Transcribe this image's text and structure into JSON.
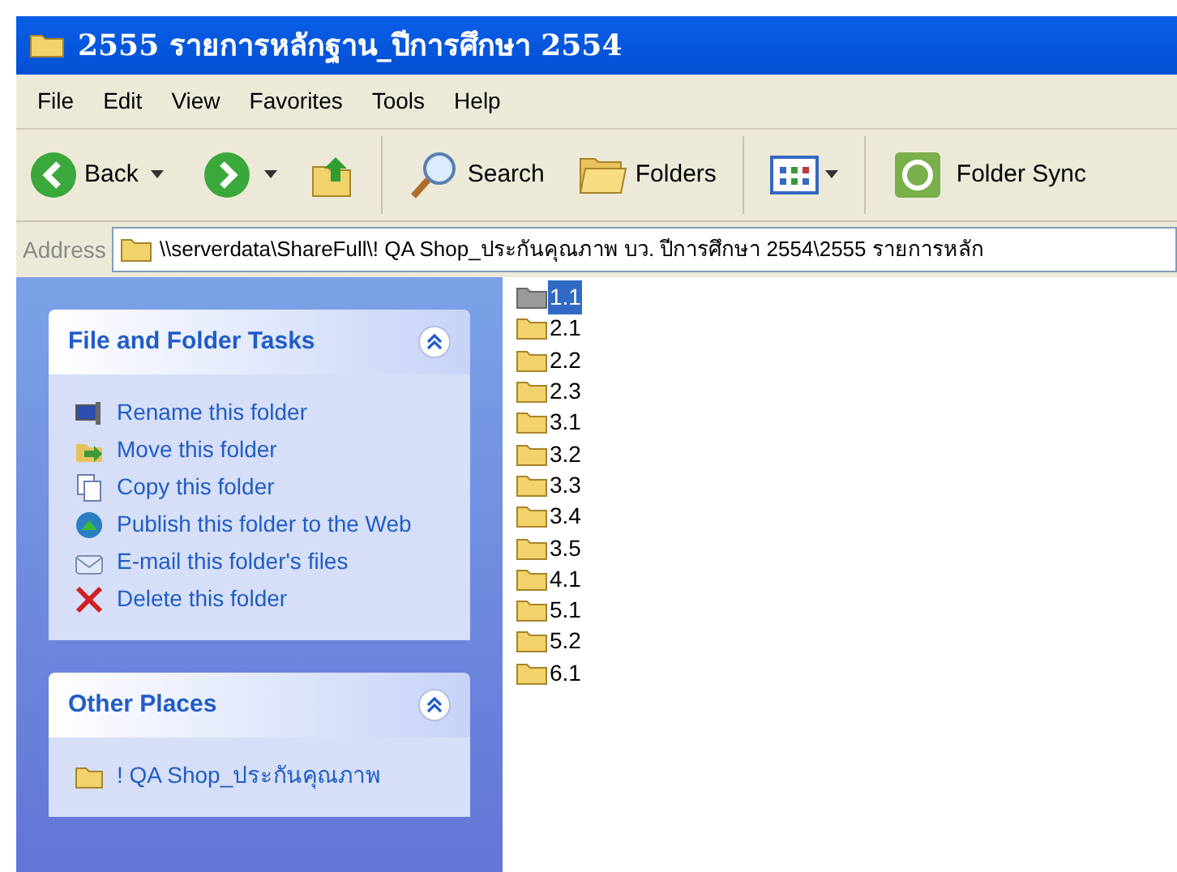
{
  "window": {
    "title": "2555 รายการหลักฐาน_ปีการศึกษา 2554"
  },
  "menu": [
    "File",
    "Edit",
    "View",
    "Favorites",
    "Tools",
    "Help"
  ],
  "toolbar": {
    "back": "Back",
    "search": "Search",
    "folders": "Folders",
    "sync": "Folder Sync"
  },
  "address": {
    "label": "Address",
    "value": "\\\\serverdata\\ShareFull\\! QA Shop_ประกันคุณภาพ บว. ปีการศึกษา 2554\\2555 รายการหลัก"
  },
  "panels": [
    {
      "title": "File and Folder Tasks",
      "expanded": true,
      "items": [
        {
          "kind": "rename",
          "label": "Rename this folder"
        },
        {
          "kind": "move",
          "label": "Move this folder"
        },
        {
          "kind": "copy",
          "label": "Copy this folder"
        },
        {
          "kind": "publish",
          "label": "Publish this folder to the Web"
        },
        {
          "kind": "email",
          "label": "E-mail this folder's files"
        },
        {
          "kind": "delete",
          "label": "Delete this folder"
        }
      ]
    },
    {
      "title": "Other Places",
      "expanded": true,
      "items": [
        {
          "kind": "folder",
          "label": "! QA Shop_ประกันคุณภาพ"
        }
      ]
    }
  ],
  "folders": [
    {
      "name": "1.1",
      "selected": true
    },
    {
      "name": "2.1",
      "selected": false
    },
    {
      "name": "2.2",
      "selected": false
    },
    {
      "name": "2.3",
      "selected": false
    },
    {
      "name": "3.1",
      "selected": false
    },
    {
      "name": "3.2",
      "selected": false
    },
    {
      "name": "3.3",
      "selected": false
    },
    {
      "name": "3.4",
      "selected": false
    },
    {
      "name": "3.5",
      "selected": false
    },
    {
      "name": "4.1",
      "selected": false
    },
    {
      "name": "5.1",
      "selected": false
    },
    {
      "name": "5.2",
      "selected": false
    },
    {
      "name": "6.1",
      "selected": false
    }
  ]
}
